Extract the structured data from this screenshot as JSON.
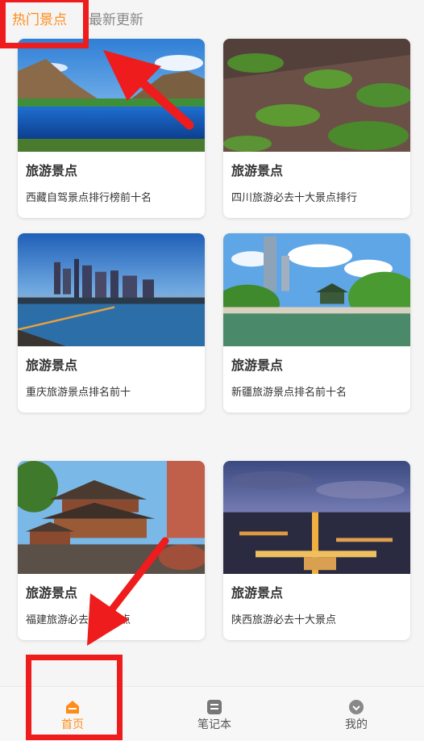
{
  "tabs": [
    {
      "label": "热门景点",
      "active": true
    },
    {
      "label": "最新更新",
      "active": false
    }
  ],
  "cards": [
    {
      "title": "旅游景点",
      "desc": "西藏自驾景点排行榜前十名",
      "image": "lake-mountain-photo"
    },
    {
      "title": "旅游景点",
      "desc": "四川旅游必去十大景点排行",
      "image": "cliff-trail-photo"
    },
    {
      "title": "旅游景点",
      "desc": "重庆旅游景点排名前十",
      "image": "city-skyline-photo"
    },
    {
      "title": "旅游景点",
      "desc": "新疆旅游景点排名前十名",
      "image": "park-tower-photo"
    },
    {
      "title": "旅游景点",
      "desc": "福建旅游必去十大景点",
      "image": "temple-photo"
    },
    {
      "title": "旅游景点",
      "desc": "陕西旅游必去十大景点",
      "image": "night-city-photo"
    }
  ],
  "bottom_nav": [
    {
      "label": "首页",
      "icon": "home-icon",
      "active": true
    },
    {
      "label": "笔记本",
      "icon": "notebook-icon",
      "active": false
    },
    {
      "label": "我的",
      "icon": "profile-icon",
      "active": false
    }
  ],
  "colors": {
    "accent": "#ff8c1a",
    "annotation": "#ee1c1c"
  }
}
